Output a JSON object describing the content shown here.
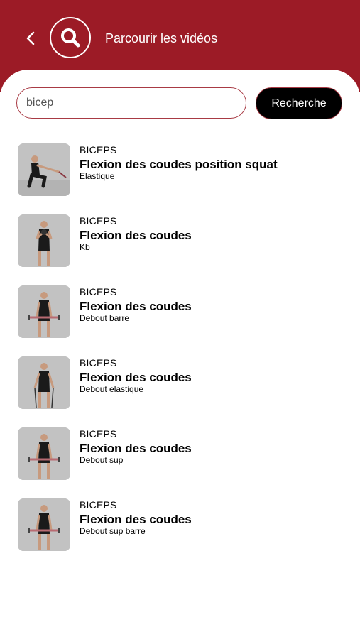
{
  "header": {
    "title": "Parcourir les vidéos",
    "background_color": "#9c1b26",
    "back_icon": "chevron-left-icon",
    "search_icon": "search-icon"
  },
  "search": {
    "value": "bicep",
    "button_label": "Recherche"
  },
  "results": [
    {
      "category": "BICEPS",
      "title": "Flexion des coudes position squat",
      "subtitle": "Elastique",
      "pose": "squat"
    },
    {
      "category": "BICEPS",
      "title": "Flexion des coudes",
      "subtitle": "Kb",
      "pose": "kettlebell"
    },
    {
      "category": "BICEPS",
      "title": "Flexion des coudes",
      "subtitle": "Debout barre",
      "pose": "barbell"
    },
    {
      "category": "BICEPS",
      "title": "Flexion des coudes",
      "subtitle": "Debout elastique",
      "pose": "band"
    },
    {
      "category": "BICEPS",
      "title": "Flexion des coudes",
      "subtitle": "Debout sup",
      "pose": "barbell"
    },
    {
      "category": "BICEPS",
      "title": "Flexion des coudes",
      "subtitle": "Debout sup barre",
      "pose": "barbell"
    }
  ]
}
